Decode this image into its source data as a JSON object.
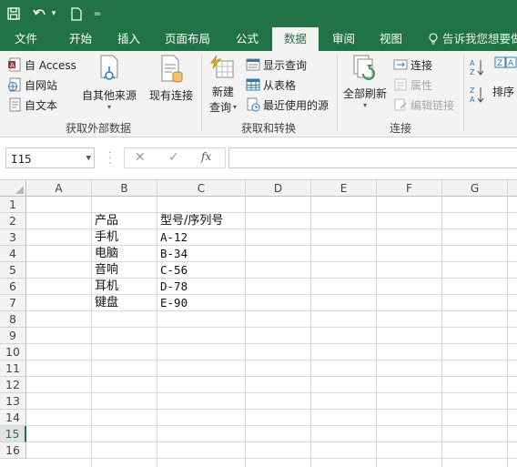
{
  "qat": {
    "dropdown_glyph": "▾",
    "more_glyph": "="
  },
  "tabs": [
    "文件",
    "开始",
    "插入",
    "页面布局",
    "公式",
    "数据",
    "审阅",
    "视图"
  ],
  "active_tab": "数据",
  "tell_me": "告诉我您想要做",
  "ribbon": {
    "get_external": {
      "access": "自 Access",
      "web": "自网站",
      "text": "自文本",
      "other": "自其他来源",
      "existing": "现有连接",
      "label": "获取外部数据"
    },
    "transform": {
      "new_query_1": "新建",
      "new_query_2": "查询",
      "show_queries": "显示查询",
      "from_table": "从表格",
      "recent_sources": "最近使用的源",
      "label": "获取和转换"
    },
    "connections": {
      "refresh_all": "全部刷新",
      "connections": "连接",
      "properties": "属性",
      "edit_links": "编辑链接",
      "label": "连接"
    },
    "sort": {
      "sort": "排序"
    }
  },
  "formula_bar": {
    "name_box": "I15",
    "cancel_glyph": "✕",
    "enter_glyph": "✓",
    "fx_glyph": "fx",
    "formula": ""
  },
  "grid": {
    "columns": [
      "A",
      "B",
      "C",
      "D",
      "E",
      "F",
      "G"
    ],
    "rows": [
      "1",
      "2",
      "3",
      "4",
      "5",
      "6",
      "7",
      "8",
      "9",
      "10",
      "11",
      "12",
      "13",
      "14",
      "15",
      "16"
    ],
    "selected_row": "15",
    "cells": {
      "B2": "产品",
      "C2": "型号/序列号",
      "B3": "手机",
      "C3": "A-12",
      "B4": "电脑",
      "C4": "B-34",
      "B5": "音响",
      "C5": "C-56",
      "B6": "耳机",
      "C6": "D-78",
      "B7": "键盘",
      "C7": "E-90"
    }
  },
  "colors": {
    "accent": "#217346",
    "ribbon_bg": "#f3f3f3"
  }
}
